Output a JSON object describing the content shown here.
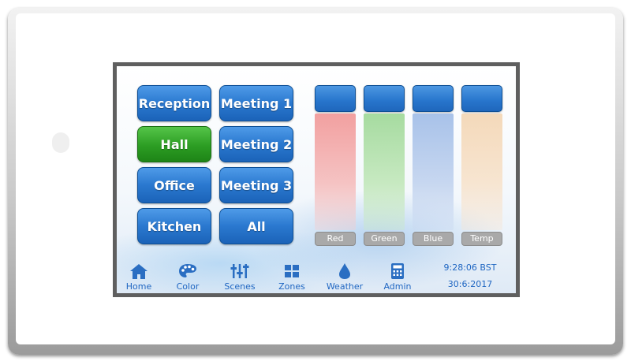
{
  "zones": [
    {
      "label": "Reception",
      "active": false
    },
    {
      "label": "Meeting 1",
      "active": false
    },
    {
      "label": "Hall",
      "active": true
    },
    {
      "label": "Meeting 2",
      "active": false
    },
    {
      "label": "Office",
      "active": false
    },
    {
      "label": "Meeting 3",
      "active": false
    },
    {
      "label": "Kitchen",
      "active": false
    },
    {
      "label": "All",
      "active": false
    }
  ],
  "sliders": [
    {
      "label": "Red",
      "color": "#f2a3a3"
    },
    {
      "label": "Green",
      "color": "#a9dca2"
    },
    {
      "label": "Blue",
      "color": "#a9c3e8"
    },
    {
      "label": "Temp",
      "color": "#f5d9b8"
    }
  ],
  "nav": [
    {
      "label": "Home",
      "icon": "home-icon"
    },
    {
      "label": "Color",
      "icon": "palette-icon"
    },
    {
      "label": "Scenes",
      "icon": "sliders-icon"
    },
    {
      "label": "Zones",
      "icon": "grid-icon"
    },
    {
      "label": "Weather",
      "icon": "droplet-icon"
    },
    {
      "label": "Admin",
      "icon": "calculator-icon"
    }
  ],
  "status": {
    "time": "9:28:06 BST",
    "date": "30:6:2017"
  },
  "colors": {
    "accent": "#2a78cf",
    "active_zone": "#2c9d23",
    "nav_text": "#1f66c2"
  }
}
